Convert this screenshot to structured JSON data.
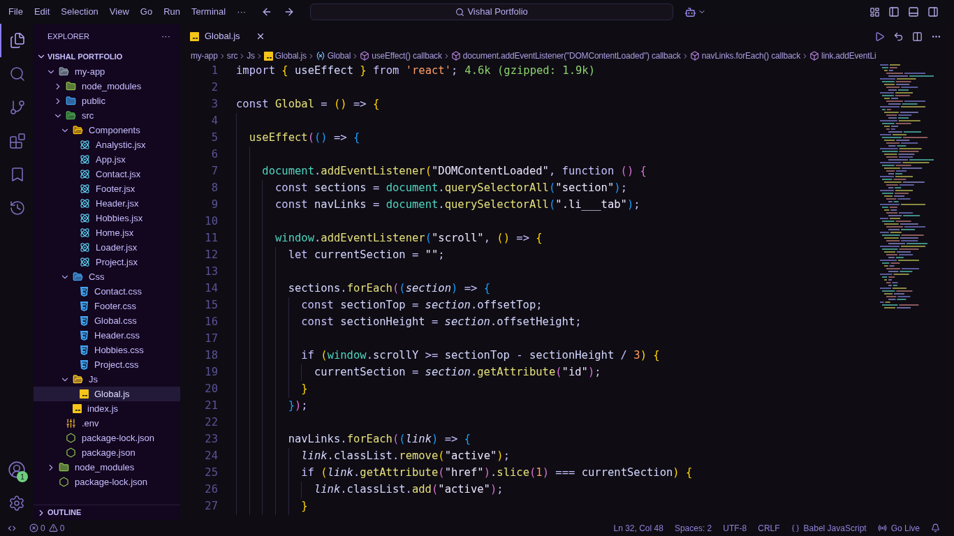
{
  "menu": [
    "File",
    "Edit",
    "Selection",
    "View",
    "Go",
    "Run",
    "Terminal",
    "···"
  ],
  "command_center": {
    "value": "Vishal Portfolio"
  },
  "activity_bar": [
    {
      "kind": "explorer",
      "selected": true
    },
    {
      "kind": "search",
      "selected": false
    },
    {
      "kind": "source-control",
      "selected": false
    },
    {
      "kind": "extensions",
      "selected": false
    },
    {
      "kind": "bookmarks",
      "selected": false
    },
    {
      "kind": "timeline",
      "selected": false
    }
  ],
  "accounts_badge": "1",
  "explorer": {
    "title": "EXPLORER",
    "more": "···",
    "root": "VISHAL PORTFOLIO",
    "outline": "OUTLINE",
    "tree": [
      {
        "name": "my-app",
        "kind": "folder",
        "expanded": true,
        "selected": false,
        "children": [
          {
            "name": "node_modules",
            "kind": "folder-node",
            "expanded": false,
            "selected": false
          },
          {
            "name": "public",
            "kind": "folder-public",
            "expanded": false,
            "selected": false
          },
          {
            "name": "src",
            "kind": "folder-src",
            "expanded": true,
            "selected": false,
            "children": [
              {
                "name": "Components",
                "kind": "folder-components",
                "expanded": true,
                "selected": false,
                "children": [
                  {
                    "name": "Analystic.jsx",
                    "kind": "jsx",
                    "selected": false
                  },
                  {
                    "name": "App.jsx",
                    "kind": "jsx",
                    "selected": false
                  },
                  {
                    "name": "Contact.jsx",
                    "kind": "jsx",
                    "selected": false
                  },
                  {
                    "name": "Footer.jsx",
                    "kind": "jsx",
                    "selected": false
                  },
                  {
                    "name": "Header.jsx",
                    "kind": "jsx",
                    "selected": false
                  },
                  {
                    "name": "Hobbies.jsx",
                    "kind": "jsx",
                    "selected": false
                  },
                  {
                    "name": "Home.jsx",
                    "kind": "jsx",
                    "selected": false
                  },
                  {
                    "name": "Loader.jsx",
                    "kind": "jsx",
                    "selected": false
                  },
                  {
                    "name": "Project.jsx",
                    "kind": "jsx",
                    "selected": false
                  }
                ]
              },
              {
                "name": "Css",
                "kind": "folder-css",
                "expanded": true,
                "selected": false,
                "children": [
                  {
                    "name": "Contact.css",
                    "kind": "css",
                    "selected": false
                  },
                  {
                    "name": "Footer.css",
                    "kind": "css",
                    "selected": false
                  },
                  {
                    "name": "Global.css",
                    "kind": "css",
                    "selected": false
                  },
                  {
                    "name": "Header.css",
                    "kind": "css",
                    "selected": false
                  },
                  {
                    "name": "Hobbies.css",
                    "kind": "css",
                    "selected": false
                  },
                  {
                    "name": "Project.css",
                    "kind": "css",
                    "selected": false
                  }
                ]
              },
              {
                "name": "Js",
                "kind": "folder-js",
                "expanded": true,
                "selected": false,
                "children": [
                  {
                    "name": "Global.js",
                    "kind": "js",
                    "selected": true
                  }
                ]
              },
              {
                "name": "index.js",
                "kind": "js",
                "selected": false
              }
            ]
          },
          {
            "name": ".env",
            "kind": "env",
            "selected": false
          },
          {
            "name": "package-lock.json",
            "kind": "json",
            "selected": false
          },
          {
            "name": "package.json",
            "kind": "json",
            "selected": false
          }
        ]
      },
      {
        "name": "node_modules",
        "kind": "folder-node",
        "expanded": false,
        "selected": false
      },
      {
        "name": "package-lock.json",
        "kind": "json",
        "selected": false
      }
    ]
  },
  "tabs": [
    {
      "label": "Global.js",
      "kind": "js",
      "selected": true
    }
  ],
  "breadcrumbs": [
    {
      "label": "my-app",
      "kind": "plain"
    },
    {
      "label": "src",
      "kind": "plain"
    },
    {
      "label": "Js",
      "kind": "plain"
    },
    {
      "label": "Global.js",
      "kind": "js"
    },
    {
      "label": "Global",
      "kind": "variable"
    },
    {
      "label": "useEffect() callback",
      "kind": "method"
    },
    {
      "label": "document.addEventListener(\"DOMContentLoaded\") callback",
      "kind": "method"
    },
    {
      "label": "navLinks.forEach() callback",
      "kind": "method"
    },
    {
      "label": "link.addEventLi",
      "kind": "method"
    }
  ],
  "code": [
    {
      "n": "1",
      "tokens": [
        {
          "text": "import",
          "kind": "kw"
        },
        {
          "text": " {",
          "kind": "b1"
        },
        {
          "text": " useEffect ",
          "kind": "var"
        },
        {
          "text": "}",
          "kind": "b1"
        },
        {
          "text": " from ",
          "kind": "kw"
        },
        {
          "text": "'react'",
          "kind": "str2"
        },
        {
          "text": ";",
          "kind": "p"
        },
        {
          "text": "4.6k (gzipped: 1.9k)",
          "kind": "hint"
        }
      ]
    },
    {
      "n": "2"
    },
    {
      "n": "3",
      "tokens": [
        {
          "text": "const",
          "kind": "kw"
        },
        {
          "text": " Global",
          "kind": "fn"
        },
        {
          "text": " = ",
          "kind": "op"
        },
        {
          "text": "()",
          "kind": "b1"
        },
        {
          "text": " => ",
          "kind": "op"
        },
        {
          "text": "{",
          "kind": "b1"
        }
      ]
    },
    {
      "n": "4"
    },
    {
      "n": "5",
      "tokens": [
        {
          "text": "  useEffect",
          "kind": "fn"
        },
        {
          "text": "(",
          "kind": "b2"
        },
        {
          "text": "()",
          "kind": "b3"
        },
        {
          "text": " => ",
          "kind": "op"
        },
        {
          "text": "{",
          "kind": "b3"
        }
      ]
    },
    {
      "n": "6"
    },
    {
      "n": "7",
      "tokens": [
        {
          "text": "    document",
          "kind": "obj"
        },
        {
          "text": ".",
          "kind": "p"
        },
        {
          "text": "addEventListener",
          "kind": "fn"
        },
        {
          "text": "(",
          "kind": "b1"
        },
        {
          "text": "\"DOMContentLoaded\"",
          "kind": "str"
        },
        {
          "text": ", function ",
          "kind": "kw"
        },
        {
          "text": "()",
          "kind": "b2"
        },
        {
          "text": " {",
          "kind": "b2"
        }
      ]
    },
    {
      "n": "8",
      "tokens": [
        {
          "text": "      const",
          "kind": "kw"
        },
        {
          "text": " sections",
          "kind": "var"
        },
        {
          "text": " = ",
          "kind": "op"
        },
        {
          "text": "document",
          "kind": "obj"
        },
        {
          "text": ".",
          "kind": "p"
        },
        {
          "text": "querySelectorAll",
          "kind": "fn"
        },
        {
          "text": "(",
          "kind": "b3"
        },
        {
          "text": "\"section\"",
          "kind": "str"
        },
        {
          "text": ")",
          "kind": "b3"
        },
        {
          "text": ";",
          "kind": "p"
        }
      ]
    },
    {
      "n": "9",
      "tokens": [
        {
          "text": "      const",
          "kind": "kw"
        },
        {
          "text": " navLinks",
          "kind": "var"
        },
        {
          "text": " = ",
          "kind": "op"
        },
        {
          "text": "document",
          "kind": "obj"
        },
        {
          "text": ".",
          "kind": "p"
        },
        {
          "text": "querySelectorAll",
          "kind": "fn"
        },
        {
          "text": "(",
          "kind": "b3"
        },
        {
          "text": "\".li___tab\"",
          "kind": "str"
        },
        {
          "text": ")",
          "kind": "b3"
        },
        {
          "text": ";",
          "kind": "p"
        }
      ]
    },
    {
      "n": "10"
    },
    {
      "n": "11",
      "tokens": [
        {
          "text": "      window",
          "kind": "obj"
        },
        {
          "text": ".",
          "kind": "p"
        },
        {
          "text": "addEventListener",
          "kind": "fn"
        },
        {
          "text": "(",
          "kind": "b3"
        },
        {
          "text": "\"scroll\"",
          "kind": "str"
        },
        {
          "text": ", ",
          "kind": "p"
        },
        {
          "text": "()",
          "kind": "b1"
        },
        {
          "text": " => ",
          "kind": "op"
        },
        {
          "text": "{",
          "kind": "b1"
        }
      ]
    },
    {
      "n": "12",
      "tokens": [
        {
          "text": "        let",
          "kind": "kw"
        },
        {
          "text": " currentSection",
          "kind": "var"
        },
        {
          "text": " = ",
          "kind": "op"
        },
        {
          "text": "\"\"",
          "kind": "str"
        },
        {
          "text": ";",
          "kind": "p"
        }
      ]
    },
    {
      "n": "13"
    },
    {
      "n": "14",
      "tokens": [
        {
          "text": "        sections",
          "kind": "var"
        },
        {
          "text": ".",
          "kind": "p"
        },
        {
          "text": "forEach",
          "kind": "fn"
        },
        {
          "text": "(",
          "kind": "b2"
        },
        {
          "text": "(",
          "kind": "b3"
        },
        {
          "text": "section",
          "kind": "param"
        },
        {
          "text": ")",
          "kind": "b3"
        },
        {
          "text": " => ",
          "kind": "op"
        },
        {
          "text": "{",
          "kind": "b3"
        }
      ]
    },
    {
      "n": "15",
      "tokens": [
        {
          "text": "          const",
          "kind": "kw"
        },
        {
          "text": " sectionTop",
          "kind": "var"
        },
        {
          "text": " = ",
          "kind": "op"
        },
        {
          "text": "section",
          "kind": "param"
        },
        {
          "text": ".",
          "kind": "p"
        },
        {
          "text": "offsetTop",
          "kind": "prop"
        },
        {
          "text": ";",
          "kind": "p"
        }
      ]
    },
    {
      "n": "16",
      "tokens": [
        {
          "text": "          const",
          "kind": "kw"
        },
        {
          "text": " sectionHeight",
          "kind": "var"
        },
        {
          "text": " = ",
          "kind": "op"
        },
        {
          "text": "section",
          "kind": "param"
        },
        {
          "text": ".",
          "kind": "p"
        },
        {
          "text": "offsetHeight",
          "kind": "prop"
        },
        {
          "text": ";",
          "kind": "p"
        }
      ]
    },
    {
      "n": "17"
    },
    {
      "n": "18",
      "tokens": [
        {
          "text": "          if",
          "kind": "kw"
        },
        {
          "text": " (",
          "kind": "b1"
        },
        {
          "text": "window",
          "kind": "obj"
        },
        {
          "text": ".",
          "kind": "p"
        },
        {
          "text": "scrollY",
          "kind": "prop"
        },
        {
          "text": " >= ",
          "kind": "op"
        },
        {
          "text": "sectionTop",
          "kind": "var"
        },
        {
          "text": " - ",
          "kind": "op"
        },
        {
          "text": "sectionHeight",
          "kind": "var"
        },
        {
          "text": " / ",
          "kind": "op"
        },
        {
          "text": "3",
          "kind": "num"
        },
        {
          "text": ")",
          "kind": "b1"
        },
        {
          "text": " {",
          "kind": "b1"
        }
      ]
    },
    {
      "n": "19",
      "tokens": [
        {
          "text": "            currentSection",
          "kind": "var"
        },
        {
          "text": " = ",
          "kind": "op"
        },
        {
          "text": "section",
          "kind": "param"
        },
        {
          "text": ".",
          "kind": "p"
        },
        {
          "text": "getAttribute",
          "kind": "fn"
        },
        {
          "text": "(",
          "kind": "b2"
        },
        {
          "text": "\"id\"",
          "kind": "str"
        },
        {
          "text": ")",
          "kind": "b2"
        },
        {
          "text": ";",
          "kind": "p"
        }
      ]
    },
    {
      "n": "20",
      "tokens": [
        {
          "text": "          }",
          "kind": "b1"
        }
      ]
    },
    {
      "n": "21",
      "tokens": [
        {
          "text": "        }",
          "kind": "b3"
        },
        {
          "text": ")",
          "kind": "b2"
        },
        {
          "text": ";",
          "kind": "p"
        }
      ]
    },
    {
      "n": "22"
    },
    {
      "n": "23",
      "tokens": [
        {
          "text": "        navLinks",
          "kind": "var"
        },
        {
          "text": ".",
          "kind": "p"
        },
        {
          "text": "forEach",
          "kind": "fn"
        },
        {
          "text": "(",
          "kind": "b2"
        },
        {
          "text": "(",
          "kind": "b3"
        },
        {
          "text": "link",
          "kind": "param"
        },
        {
          "text": ")",
          "kind": "b3"
        },
        {
          "text": " => ",
          "kind": "op"
        },
        {
          "text": "{",
          "kind": "b3"
        }
      ]
    },
    {
      "n": "24",
      "tokens": [
        {
          "text": "          link",
          "kind": "param"
        },
        {
          "text": ".",
          "kind": "p"
        },
        {
          "text": "classList",
          "kind": "prop"
        },
        {
          "text": ".",
          "kind": "p"
        },
        {
          "text": "remove",
          "kind": "fn"
        },
        {
          "text": "(",
          "kind": "b1"
        },
        {
          "text": "\"active\"",
          "kind": "str"
        },
        {
          "text": ")",
          "kind": "b1"
        },
        {
          "text": ";",
          "kind": "p"
        }
      ]
    },
    {
      "n": "25",
      "tokens": [
        {
          "text": "          if",
          "kind": "kw"
        },
        {
          "text": " (",
          "kind": "b1"
        },
        {
          "text": "link",
          "kind": "param"
        },
        {
          "text": ".",
          "kind": "p"
        },
        {
          "text": "getAttribute",
          "kind": "fn"
        },
        {
          "text": "(",
          "kind": "b2"
        },
        {
          "text": "\"href\"",
          "kind": "str"
        },
        {
          "text": ")",
          "kind": "b2"
        },
        {
          "text": ".",
          "kind": "p"
        },
        {
          "text": "slice",
          "kind": "fn"
        },
        {
          "text": "(",
          "kind": "b2"
        },
        {
          "text": "1",
          "kind": "num"
        },
        {
          "text": ")",
          "kind": "b2"
        },
        {
          "text": " === ",
          "kind": "op"
        },
        {
          "text": "currentSection",
          "kind": "var"
        },
        {
          "text": ")",
          "kind": "b1"
        },
        {
          "text": " {",
          "kind": "b1"
        }
      ]
    },
    {
      "n": "26",
      "tokens": [
        {
          "text": "            link",
          "kind": "param"
        },
        {
          "text": ".",
          "kind": "p"
        },
        {
          "text": "classList",
          "kind": "prop"
        },
        {
          "text": ".",
          "kind": "p"
        },
        {
          "text": "add",
          "kind": "fn"
        },
        {
          "text": "(",
          "kind": "b2"
        },
        {
          "text": "\"active\"",
          "kind": "str"
        },
        {
          "text": ")",
          "kind": "b2"
        },
        {
          "text": ";",
          "kind": "p"
        }
      ]
    },
    {
      "n": "27",
      "tokens": [
        {
          "text": "          }",
          "kind": "b1"
        }
      ]
    }
  ],
  "status_bar": {
    "errors": "0",
    "warnings": "0",
    "right": [
      {
        "label": "Ln 32, Col 48",
        "kind": "plain"
      },
      {
        "label": "Spaces: 2",
        "kind": "plain"
      },
      {
        "label": "UTF-8",
        "kind": "plain"
      },
      {
        "label": "CRLF",
        "kind": "plain"
      },
      {
        "label": "Babel JavaScript",
        "kind": "braces"
      },
      {
        "label": "Go Live",
        "kind": "broadcast"
      },
      {
        "kind": "bell"
      }
    ]
  }
}
